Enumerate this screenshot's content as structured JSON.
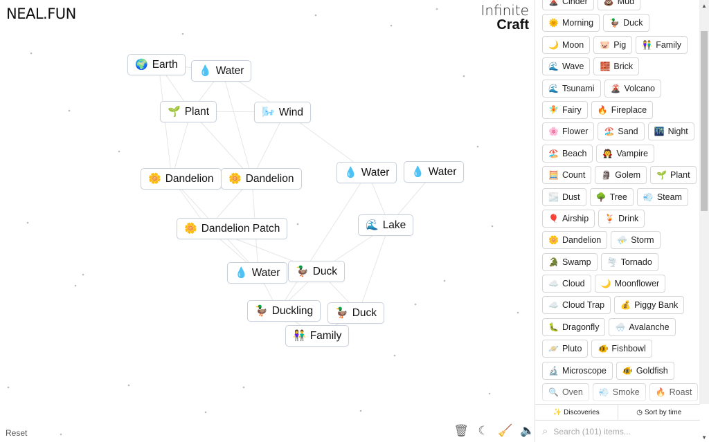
{
  "header": {
    "logo": "NEAL.FUN",
    "brand_line1": "Infinite",
    "brand_line2": "Craft"
  },
  "canvas_items": [
    {
      "emoji": "🌍",
      "label": "Earth"
    },
    {
      "emoji": "💧",
      "label": "Water"
    },
    {
      "emoji": "🌱",
      "label": "Plant"
    },
    {
      "emoji": "🌬️",
      "label": "Wind"
    },
    {
      "emoji": "🌼",
      "label": "Dandelion"
    },
    {
      "emoji": "🌼",
      "label": "Dandelion"
    },
    {
      "emoji": "💧",
      "label": "Water"
    },
    {
      "emoji": "💧",
      "label": "Water"
    },
    {
      "emoji": "🌼",
      "label": "Dandelion Patch"
    },
    {
      "emoji": "🌊",
      "label": "Lake"
    },
    {
      "emoji": "💧",
      "label": "Water"
    },
    {
      "emoji": "🦆",
      "label": "Duck"
    },
    {
      "emoji": "🦆",
      "label": "Duckling"
    },
    {
      "emoji": "🦆",
      "label": "Duck"
    },
    {
      "emoji": "👫",
      "label": "Family"
    }
  ],
  "footer": {
    "reset": "Reset",
    "icons": [
      "trash-icon",
      "moon-icon",
      "broom-icon",
      "sound-icon"
    ]
  },
  "sidebar": {
    "items": [
      {
        "emoji": "🌋",
        "label": "Cinder"
      },
      {
        "emoji": "💩",
        "label": "Mud"
      },
      {
        "emoji": "🌞",
        "label": "Morning"
      },
      {
        "emoji": "🦆",
        "label": "Duck"
      },
      {
        "emoji": "🌙",
        "label": "Moon"
      },
      {
        "emoji": "🐷",
        "label": "Pig"
      },
      {
        "emoji": "👫",
        "label": "Family"
      },
      {
        "emoji": "🌊",
        "label": "Wave"
      },
      {
        "emoji": "🧱",
        "label": "Brick"
      },
      {
        "emoji": "🌊",
        "label": "Tsunami"
      },
      {
        "emoji": "🌋",
        "label": "Volcano"
      },
      {
        "emoji": "🧚",
        "label": "Fairy"
      },
      {
        "emoji": "🔥",
        "label": "Fireplace"
      },
      {
        "emoji": "🌸",
        "label": "Flower"
      },
      {
        "emoji": "🏖️",
        "label": "Sand"
      },
      {
        "emoji": "🌃",
        "label": "Night"
      },
      {
        "emoji": "🏖️",
        "label": "Beach"
      },
      {
        "emoji": "🧛",
        "label": "Vampire"
      },
      {
        "emoji": "🧮",
        "label": "Count"
      },
      {
        "emoji": "🗿",
        "label": "Golem"
      },
      {
        "emoji": "🌱",
        "label": "Plant"
      },
      {
        "emoji": "🌫️",
        "label": "Dust"
      },
      {
        "emoji": "🌳",
        "label": "Tree"
      },
      {
        "emoji": "💨",
        "label": "Steam"
      },
      {
        "emoji": "🎈",
        "label": "Airship"
      },
      {
        "emoji": "🍹",
        "label": "Drink"
      },
      {
        "emoji": "🌼",
        "label": "Dandelion"
      },
      {
        "emoji": "⛈️",
        "label": "Storm"
      },
      {
        "emoji": "🐊",
        "label": "Swamp"
      },
      {
        "emoji": "🌪️",
        "label": "Tornado"
      },
      {
        "emoji": "☁️",
        "label": "Cloud"
      },
      {
        "emoji": "🌙",
        "label": "Moonflower"
      },
      {
        "emoji": "☁️",
        "label": "Cloud Trap"
      },
      {
        "emoji": "💰",
        "label": "Piggy Bank"
      },
      {
        "emoji": "🐛",
        "label": "Dragonfly"
      },
      {
        "emoji": "🌨️",
        "label": "Avalanche"
      },
      {
        "emoji": "🪐",
        "label": "Pluto"
      },
      {
        "emoji": "🐠",
        "label": "Fishbowl"
      },
      {
        "emoji": "🔬",
        "label": "Microscope"
      },
      {
        "emoji": "🐠",
        "label": "Goldfish"
      },
      {
        "emoji": "🔍",
        "label": "Oven"
      },
      {
        "emoji": "💨",
        "label": "Smoke"
      },
      {
        "emoji": "🔥",
        "label": "Roast"
      }
    ],
    "discoveries_label": "Discoveries",
    "sort_label": "Sort by time",
    "search_placeholder": "Search (101) items..."
  }
}
